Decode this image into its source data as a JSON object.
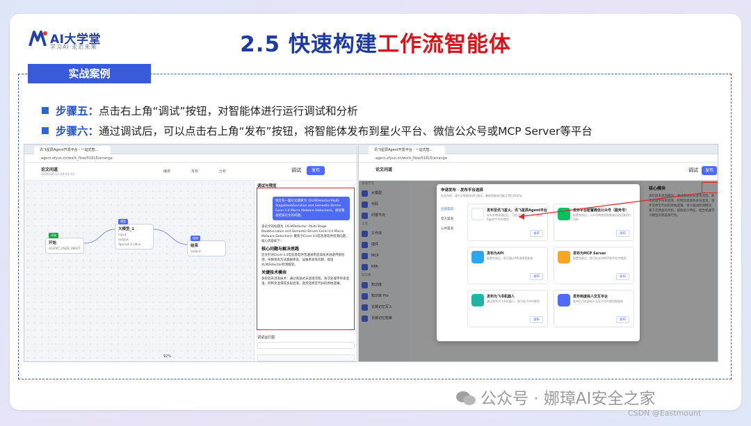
{
  "logo": {
    "text": "AI大学堂",
    "sub": "学习AI·走近未来"
  },
  "title": {
    "main": "2.5 快速构建",
    "highlight": "工作流智能体"
  },
  "section": {
    "label": "实战案例"
  },
  "steps": [
    {
      "label": "步骤五：",
      "text": "点击右上角“调试”按钮，对智能体进行运行调试和分析"
    },
    {
      "label": "步骤六：",
      "text": "通过调试后，可以点击右上角“发布”按钮，将智能体发布到星火平台、微信公众号或MCP Server等平台"
    }
  ],
  "left_shot": {
    "tab": "讯飞星辰Agent开发平台 - 一站式智...",
    "url": "agent.xfyun.cn/work_flow/51815/arrange",
    "app_title": "论文问道",
    "app_meta": "2026-04-11 20:01:12",
    "tabs": [
      "编排",
      "发布",
      "分析"
    ],
    "debug_label": "调试",
    "publish_label": "发布",
    "panel_title": "调试与预览",
    "user_msg": "现在有一篇论文题目为《XLMDetector:Multi-StageDeobfuscation and Semantic-Driven Excel 4.0 Macro Malware Detection》，请帮我总结该论文的问题。",
    "bot_intro": "该论文的标题为《XLMDetector: Multi-Stage Deobfuscation and Semantic-Driven Excel 4.0 Macro Malware Detection》聚焦于Excel 4.0宏恶意软件检测问题，核心内容如下：",
    "bot_h1": "核心问题与解决思路",
    "bot_p1": "近文针对Excel 4.0宏恶意软件普遍采用混淆技术逃避传统检测，导致现有方法漏报率高、误报率高等问题，提出XLMDetector检测框架。",
    "bot_h2": "关键技术模块",
    "bot_p2": "多阶段去混淆技术：通过渐进式去混淆流程，依次处理字符串混淆、控制流混淆等多层混淆，逐步还原宏代码的原始逻辑。",
    "run_label": "调试运行图",
    "nodes": [
      {
        "title": "开始",
        "tag": "开始",
        "p1": "AGENT_USER_INPUT"
      },
      {
        "title": "大模型_1",
        "tag": "模型",
        "p1": "input",
        "p2": "output",
        "p3": "Spark4.0 Ultra"
      },
      {
        "title": "结束",
        "tag": "结束",
        "p1": "output"
      }
    ],
    "zoom": "92%"
  },
  "right_shot": {
    "tab": "讯飞星辰Agent开发平台 - 一站式智...",
    "url": "agent.xfyun.cn/work_flow/51815/arrange",
    "app_title": "论文问道",
    "debug_label": "调试",
    "publish_label": "发布",
    "sidebar_group1": "基础节点",
    "sidebar_items1": [
      "大模型",
      "代码",
      "问答节点"
    ],
    "sidebar_group2": "工具",
    "sidebar_items2": [
      "工作流",
      "插件",
      "MCP",
      "RPA"
    ],
    "sidebar_group3": "知识库",
    "sidebar_items3": [
      "知识库",
      "知识库 Pro",
      "长期记忆写入",
      "长期记忆检索"
    ],
    "modal_title": "申请发布 · 发布平台选择",
    "modal_desc": "在发布前，请先对智能体进行调试，确保智能体功能正常后再发布。",
    "modal_nav": [
      "全部渠道",
      "官方渠道",
      "公共渠道"
    ],
    "cards": [
      {
        "title": "发布至讯飞星火、讯飞星辰Agent平台",
        "desc": "发布并审核通过后，可在讯飞星火、讯飞星辰Agent平台中使用",
        "btn": "发布",
        "color": "#ffffff"
      },
      {
        "title": "发布平台配置微信公众号（服务号）",
        "desc": "配置完成后，公众号将使用智能体自动回复用户消息",
        "btn": "发布",
        "color": "#07c160"
      },
      {
        "title": "发布为API",
        "desc": "配置完成后，即可通过API调用智能体",
        "btn": "发布",
        "color": "#2aa7f0"
      },
      {
        "title": "发布为MCP Server",
        "desc": "配置完成后，即可在支持MCP的平台中使用",
        "btn": "发布",
        "color": "#f5a623"
      },
      {
        "title": "发布为飞书机器人",
        "desc": "通过发布为飞书机器人，即可在飞书中使用",
        "btn": "发布",
        "color": "#1fb4a5"
      },
      {
        "title": "发布到虚拟人交互平台",
        "desc": "发布后可在虚拟人交互平台中使用智能体",
        "btn": "发布",
        "color": "#4f6bf5"
      }
    ],
    "rpanel_title": "核心模块",
    "rpanel_text": "多阶段去混淆模块：通过渐进式去混淆流程，依次处理字符串混淆、控制流混淆等多层混淆，逐步还原宏代码的原始逻辑。语义驱动检测模块：基于还原后的代码，提取语义特征，结合机器学习模型识别恶意行为。"
  },
  "watermark": "公众号 · 娜璋AI安全之家",
  "csdn": "CSDN @Eastmount"
}
